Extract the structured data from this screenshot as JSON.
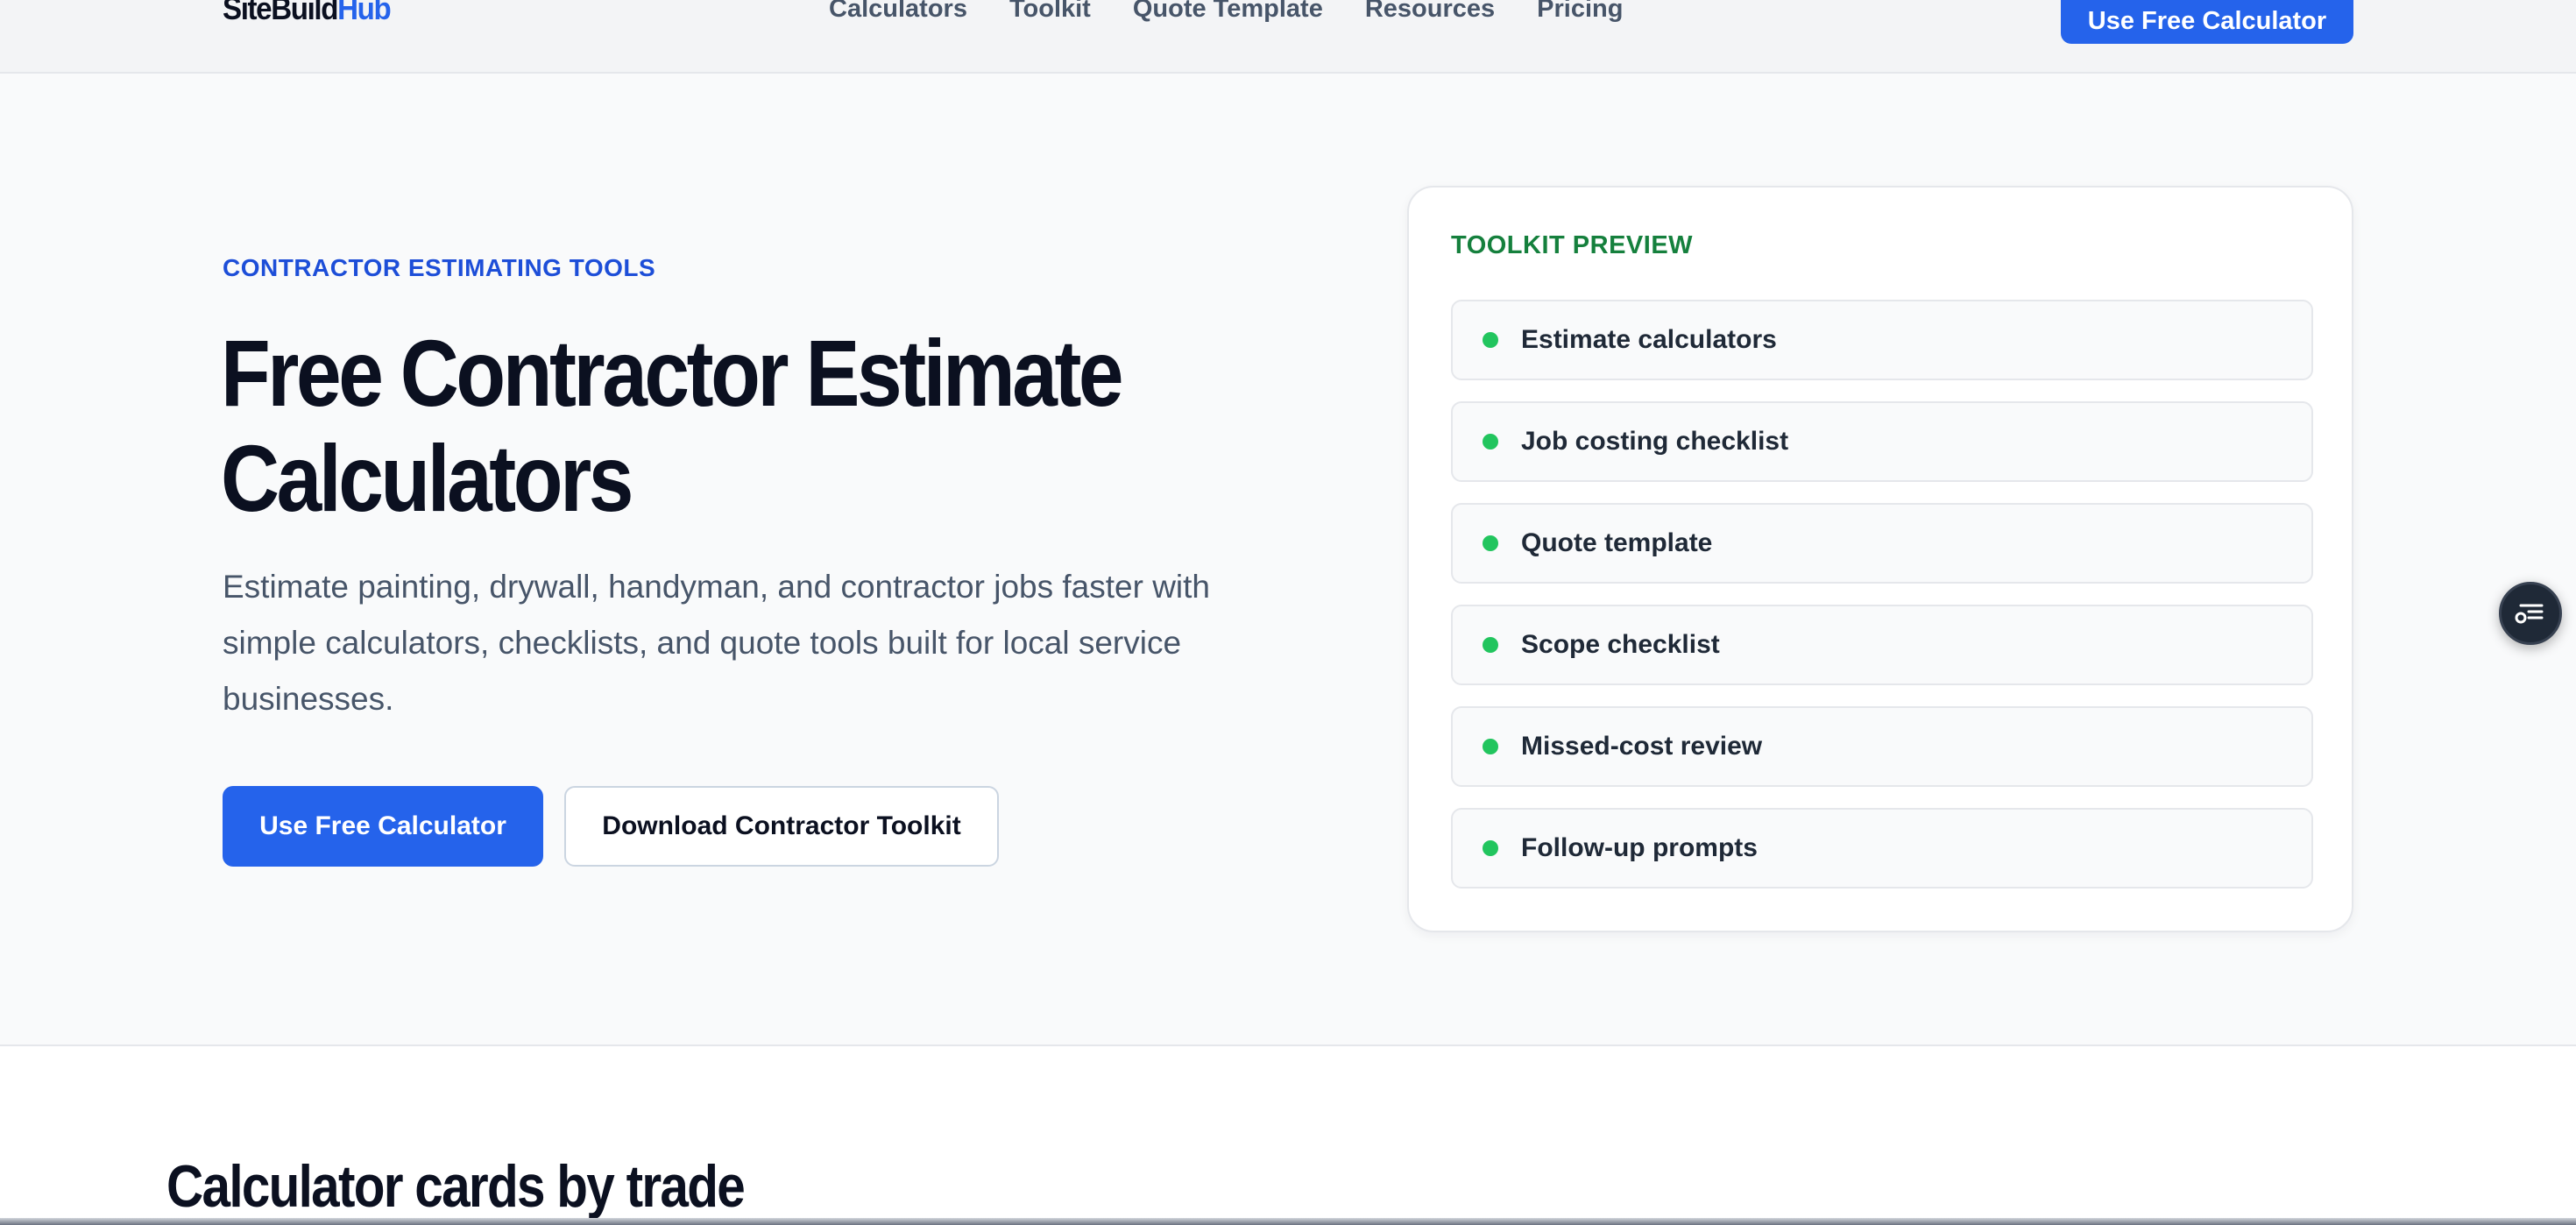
{
  "nav": {
    "logo_primary": "SiteBuild",
    "logo_accent": "Hub",
    "links": [
      "Calculators",
      "Toolkit",
      "Quote Template",
      "Resources",
      "Pricing"
    ],
    "cta_label": "Use Free Calculator"
  },
  "hero": {
    "eyebrow": "CONTRACTOR ESTIMATING TOOLS",
    "title": "Free Contractor Estimate Calculators",
    "subtitle": "Estimate painting, drywall, handyman, and contractor jobs faster with simple calculators, checklists, and quote tools built for local service businesses.",
    "primary_button": "Use Free Calculator",
    "secondary_button": "Download Contractor Toolkit"
  },
  "toolkit": {
    "title": "TOOLKIT PREVIEW",
    "items": [
      "Estimate calculators",
      "Job costing checklist",
      "Quote template",
      "Scope checklist",
      "Missed-cost review",
      "Follow-up prompts"
    ]
  },
  "floating_widget": {
    "icon": "list-filter-icon"
  },
  "section": {
    "title": "Calculator cards by trade"
  },
  "colors": {
    "accent": "#2563eb",
    "eyebrow": "#1d4ed8",
    "toolkit_title": "#15803d",
    "bullet": "#22c55e"
  }
}
